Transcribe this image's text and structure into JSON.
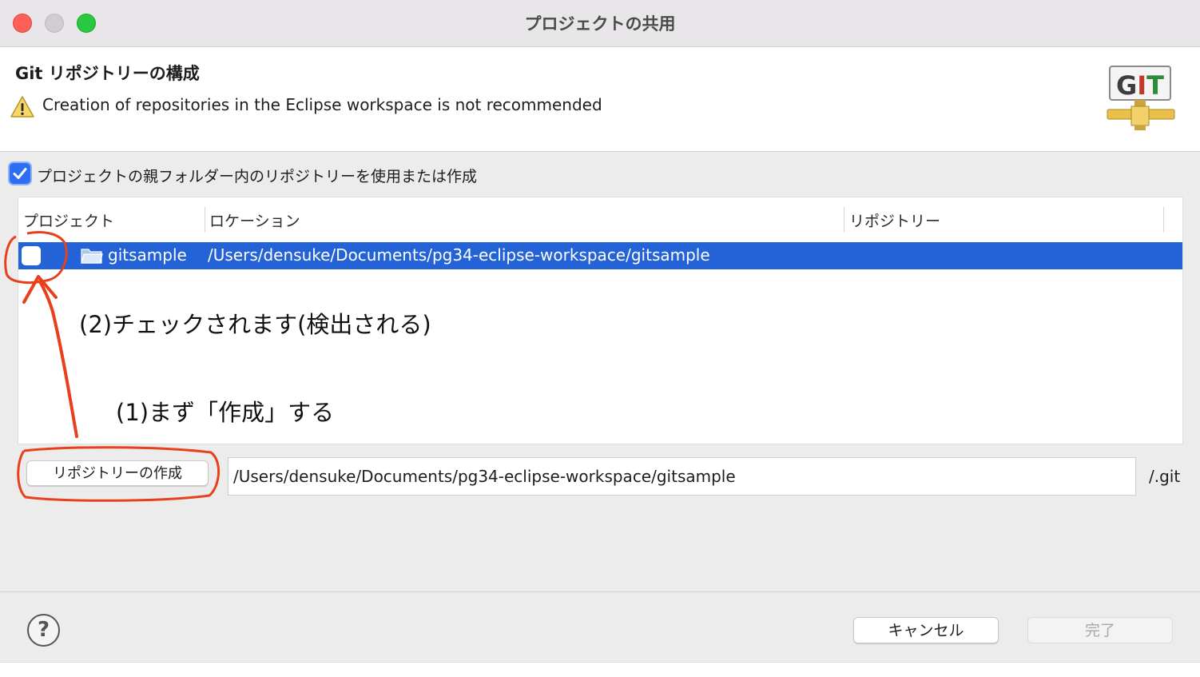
{
  "window": {
    "title": "プロジェクトの共用"
  },
  "banner": {
    "title": "Git リポジトリーの構成",
    "warning": "Creation of repositories in the Eclipse workspace is not recommended",
    "logo_text": "GIT"
  },
  "options": {
    "use_parent_label": "プロジェクトの親フォルダー内のリポジトリーを使用または作成",
    "use_parent_checked": true
  },
  "table": {
    "columns": [
      "プロジェクト",
      "ロケーション",
      "リポジトリー"
    ],
    "rows": [
      {
        "project": "gitsample",
        "location": "/Users/densuke/Documents/pg34-eclipse-workspace/gitsample",
        "repository": "",
        "checked": false,
        "selected": true
      }
    ]
  },
  "annotations": {
    "step2": "(2)チェックされます(検出される)",
    "step1": "(1)まず「作成」する",
    "color": "#e8401c"
  },
  "create": {
    "button_label": "リポジトリーの作成",
    "path_value": "/Users/densuke/Documents/pg34-eclipse-workspace/gitsample",
    "suffix": "/.git"
  },
  "footer": {
    "cancel_label": "キャンセル",
    "finish_label": "完了",
    "help_icon": "help-icon"
  },
  "colors": {
    "selection": "#2462d8",
    "accent": "#2d6ff0"
  }
}
